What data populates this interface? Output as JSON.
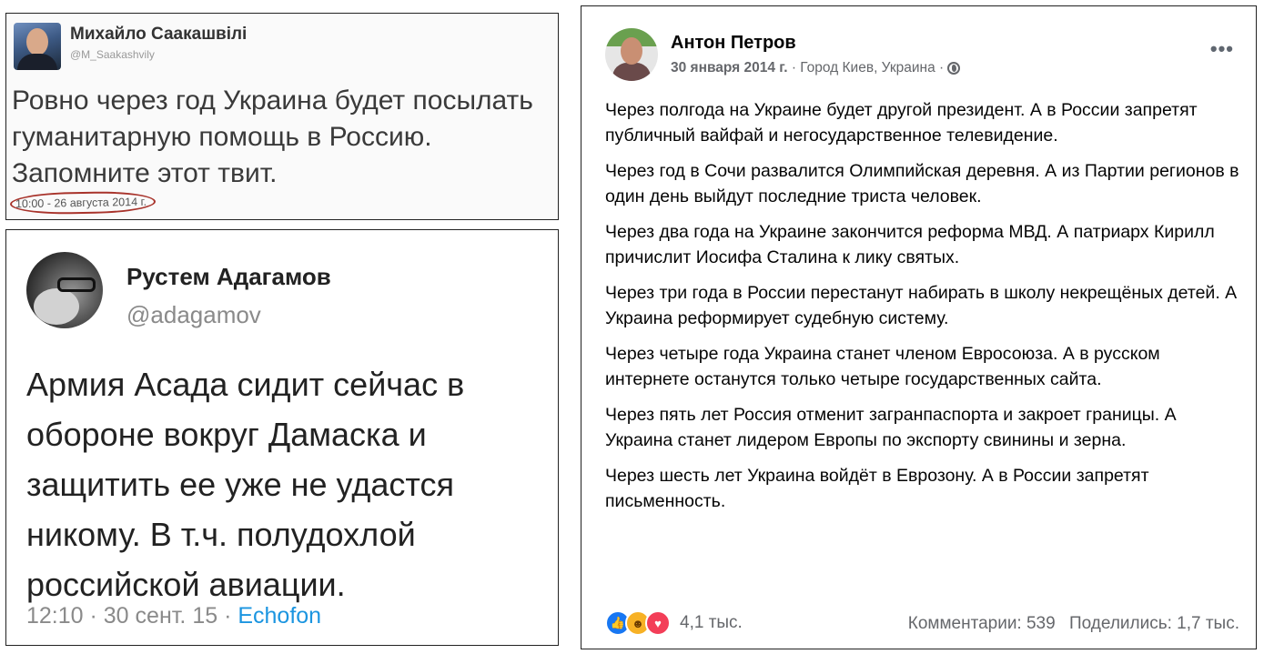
{
  "tweet1": {
    "name": "Михайло Саакашвілі",
    "handle": "@M_Saakashvily",
    "text": "Ровно через год Украина будет посылать гуманитарную помощь в Россию. Запомните этот твит.",
    "timestamp": "10:00 - 26 августа 2014 г."
  },
  "tweet2": {
    "name": "Рустем Адагамов",
    "handle": "@adagamov",
    "text": "Армия Асада сидит сейчас в обороне вокруг Дамаска и защитить ее уже не удастся никому. В т.ч. полудохлой российской авиации.",
    "time": "12:10",
    "date": "30 сент. 15",
    "client": "Echofon",
    "separator": " · "
  },
  "fb_post": {
    "author": "Антон Петров",
    "date": "30 января 2014 г.",
    "location": "Город Киев, Украина",
    "separator": " · ",
    "more_label": "•••",
    "paragraphs": [
      "Через полгода на Украине будет другой президент. А в России запретят публичный вайфай и негосударственное телевидение.",
      "Через год в Сочи развалится Олимпийская деревня. А из Партии регионов в один день выйдут последние триста человек.",
      "Через два года на Украине закончится реформа МВД. А патриарх Кирилл причислит Иосифа Сталина к лику святых.",
      "Через три года в России перестанут набирать в школу некрещёных детей. А Украина реформирует судебную систему.",
      "Через четыре года Украина станет членом Евросоюза. А в русском интернете останутся только четыре государственных сайта.",
      "Через пять лет Россия отменит загранпаспорта и закроет границы. А Украина станет лидером Европы по экспорту свинины и зерна.",
      "Через шесть лет Украина войдёт в Еврозону. А в России запретят письменность."
    ],
    "reactions": {
      "icons": [
        "like-icon",
        "haha-icon",
        "love-icon"
      ],
      "count": "4,1 тыс."
    },
    "comments": "Комментарии: 539",
    "shares": "Поделились: 1,7 тыс."
  }
}
